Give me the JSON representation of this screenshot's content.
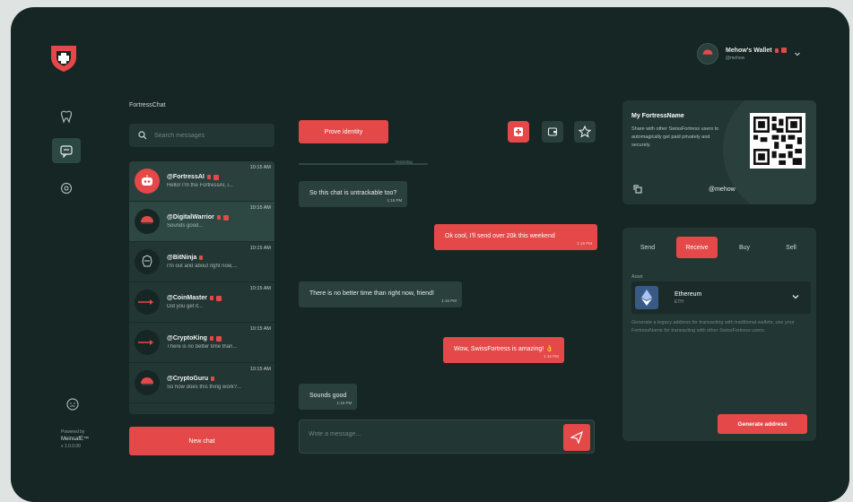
{
  "colors": {
    "accent": "#e54848",
    "background": "#162624",
    "panel": "#223633",
    "outer": "#dfe4e3"
  },
  "sidebar": {
    "logo": "shield-cross-logo",
    "nav": [
      {
        "icon": "tooth-icon",
        "active": false
      },
      {
        "icon": "chat-icon",
        "active": true
      },
      {
        "icon": "gear-icon",
        "active": false
      }
    ],
    "footer": {
      "icon": "face-icon",
      "powered_by": "Powered by",
      "brand": "MeinsafE™",
      "version": "v 1.0.0.00"
    }
  },
  "chat_list": {
    "app_title": "FortressChat",
    "search_placeholder": "Search messages",
    "items": [
      {
        "name": "@FortressAI",
        "preview": "Hello! I'm the FortressAI, i...",
        "time": "10:15 AM",
        "avatar": "robot"
      },
      {
        "name": "@DigitalWarrior",
        "preview": "Sounds good...",
        "time": "10:15 AM",
        "avatar": "helmet"
      },
      {
        "name": "@BitNinja",
        "preview": "I'm out and about right now,...",
        "time": "10:15 AM",
        "avatar": "ninja"
      },
      {
        "name": "@CoinMaster",
        "preview": "Did you get it...",
        "time": "10:15 AM",
        "avatar": "arrow"
      },
      {
        "name": "@CryptoKing",
        "preview": "There is no better time than...",
        "time": "10:15 AM",
        "avatar": "arrow"
      },
      {
        "name": "@CryptoGuru",
        "preview": "So how does this thing work?...",
        "time": "10:15 AM",
        "avatar": "helmet"
      }
    ],
    "new_chat_label": "New chat"
  },
  "conversation": {
    "prove_label": "Prove identity",
    "date_label": "Yesterday",
    "messages": [
      {
        "from": "them",
        "text": "So this chat is untrackable too?",
        "time": "1:15 PM"
      },
      {
        "from": "me",
        "text": "Ok cool, I'll send over 20k this weekend",
        "time": "1:16 PM"
      },
      {
        "from": "them",
        "text": "There is no better time than right now, friend!",
        "time": "1:16 PM"
      },
      {
        "from": "me",
        "text": "Wow, SwissFortress is amazing! 👌",
        "time": "1:16 PM"
      },
      {
        "from": "them",
        "text": "Sounds good",
        "time": "1:16 PM"
      }
    ],
    "compose_placeholder": "Write a message..."
  },
  "wallet": {
    "name": "Mehow's Wallet",
    "handle": "@mehow"
  },
  "fortress_card": {
    "title": "My FortressName",
    "text": "Share with other SwissFortress users to automagically get paid privately and securely.",
    "handle": "@mehow"
  },
  "payments": {
    "tabs": [
      "Send",
      "Receive",
      "Buy",
      "Sell"
    ],
    "active_tab": "Receive",
    "asset_label": "Asset",
    "asset_name": "Ethereum",
    "asset_symbol": "ETH",
    "description": "Generate a legacy address for transacting with traditional wallets, use your FortressName for transacting with other SwissFortress users.",
    "generate_label": "Generate address"
  }
}
